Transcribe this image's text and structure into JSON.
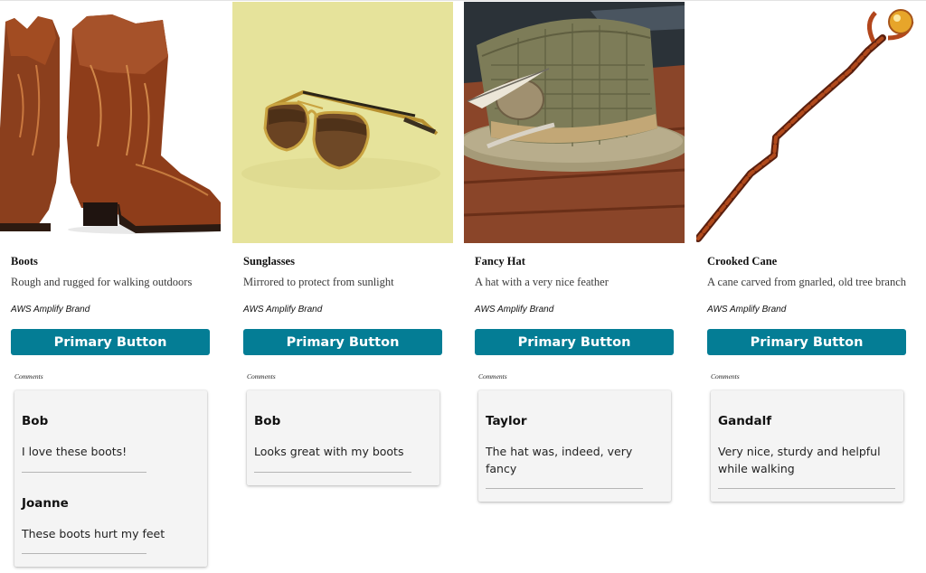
{
  "products": [
    {
      "title": "Boots",
      "description": "Rough and rugged for walking outdoors",
      "brand": "AWS Amplify Brand",
      "button_label": "Primary Button",
      "comments_label": "Comments",
      "comments": [
        {
          "author": "Bob",
          "text": "I love these boots!"
        },
        {
          "author": "Joanne",
          "text": "These boots hurt my feet"
        }
      ]
    },
    {
      "title": "Sunglasses",
      "description": "Mirrored to protect from sunlight",
      "brand": "AWS Amplify Brand",
      "button_label": "Primary Button",
      "comments_label": "Comments",
      "comments": [
        {
          "author": "Bob",
          "text": "Looks great with my boots"
        }
      ]
    },
    {
      "title": "Fancy Hat",
      "description": "A hat with a very nice feather",
      "brand": "AWS Amplify Brand",
      "button_label": "Primary Button",
      "comments_label": "Comments",
      "comments": [
        {
          "author": "Taylor",
          "text": "The hat was, indeed, very fancy"
        }
      ]
    },
    {
      "title": "Crooked Cane",
      "description": "A cane carved from gnarled, old tree branch",
      "brand": "AWS Amplify Brand",
      "button_label": "Primary Button",
      "comments_label": "Comments",
      "comments": [
        {
          "author": "Gandalf",
          "text": "Very nice, sturdy and helpful while walking"
        }
      ]
    }
  ],
  "colors": {
    "primary_button": "#047d95",
    "comment_panel": "#f4f4f4"
  }
}
